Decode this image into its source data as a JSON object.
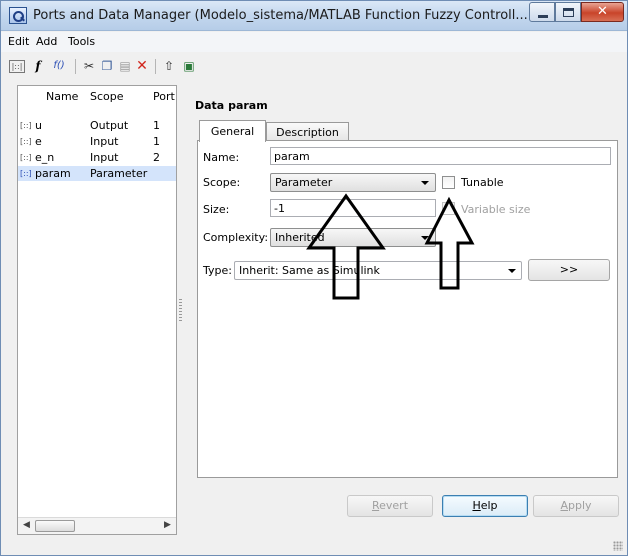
{
  "window": {
    "title": "Ports and Data Manager (Modelo_sistema/MATLAB Function Fuzzy Controll..."
  },
  "menu": [
    "Edit",
    "Add",
    "Tools"
  ],
  "toolbar": {
    "icons": [
      "data-icon",
      "add-function-icon",
      "add-fcall-icon",
      "cut-icon",
      "copy-icon",
      "paste-icon",
      "delete-icon",
      "up-icon",
      "model-explorer-icon"
    ],
    "fcall_glyph": "f()",
    "function_glyph": "f"
  },
  "left_pane": {
    "columns": [
      "Name",
      "Scope",
      "Port"
    ],
    "rows": [
      {
        "name": "u",
        "scope": "Output",
        "port": "1"
      },
      {
        "name": "e",
        "scope": "Input",
        "port": "1"
      },
      {
        "name": "e_n",
        "scope": "Input",
        "port": "2"
      },
      {
        "name": "param",
        "scope": "Parameter",
        "port": ""
      }
    ],
    "selected_index": 3,
    "scroll_left": "◀",
    "scroll_right": "▶"
  },
  "detail": {
    "title": "Data param",
    "tabs": [
      "General",
      "Description"
    ],
    "active_tab": "General",
    "name_label": "Name:",
    "name_value": "param",
    "scope_label": "Scope:",
    "scope_value": "Parameter",
    "tunable_label": "Tunable",
    "tunable_checked": false,
    "size_label": "Size:",
    "size_value": "-1",
    "variable_size_label": "Variable size",
    "complexity_label": "Complexity:",
    "complexity_value": "Inherited",
    "type_label": "Type:",
    "type_value": "Inherit: Same as Simulink",
    "type_button": ">>"
  },
  "buttons": {
    "revert": "Revert",
    "help": "Help",
    "apply": "Apply"
  },
  "colors": {
    "selection": "#d4e4fb",
    "titlebar": "#c3d7ee",
    "close": "#c9442a"
  }
}
